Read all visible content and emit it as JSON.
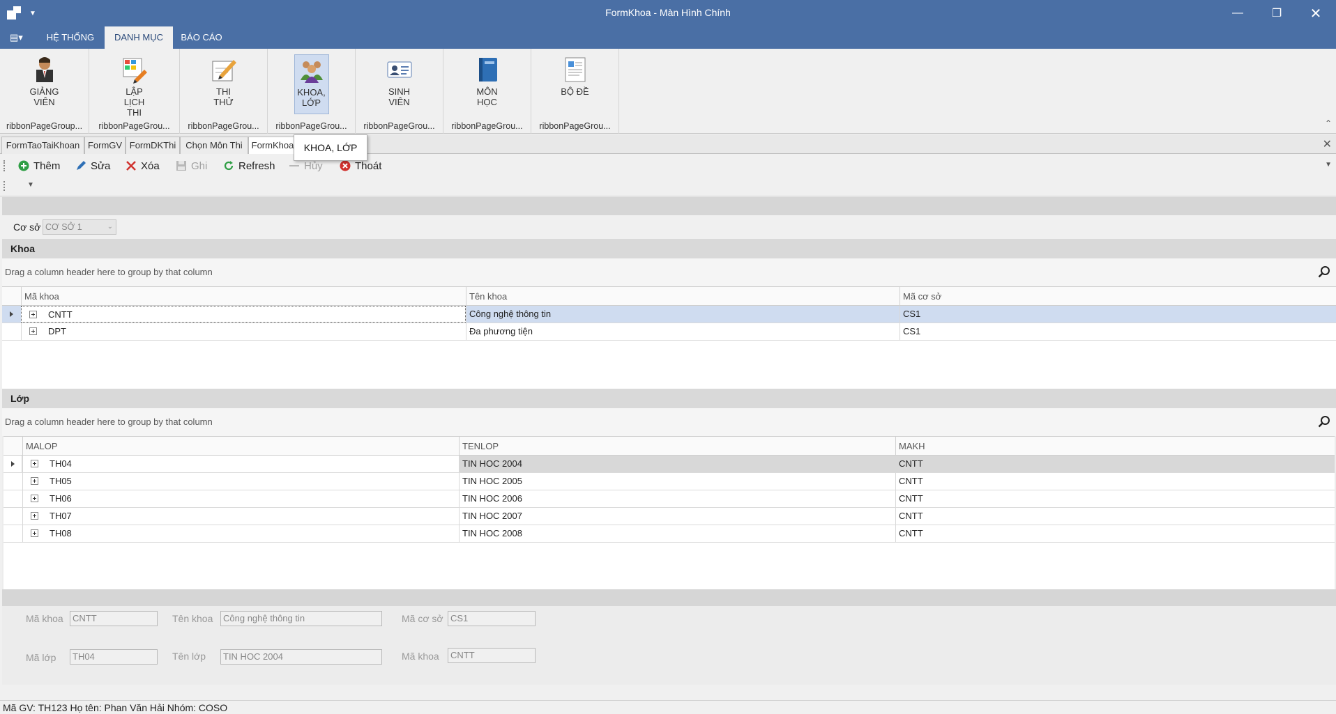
{
  "window": {
    "title": "FormKhoa - Màn Hình Chính"
  },
  "ribbon": {
    "tabs": [
      "HỆ THỐNG",
      "DANH MỤC",
      "BÁO CÁO"
    ],
    "groups": [
      {
        "label": "GIẢNG\nVIÊN",
        "caption": "ribbonPageGroup..."
      },
      {
        "label": "LẬP LỊCH\nTHI",
        "caption": "ribbonPageGrou..."
      },
      {
        "label": "THI THỬ",
        "caption": "ribbonPageGrou..."
      },
      {
        "label": "KHOA,\nLỚP",
        "caption": "ribbonPageGrou..."
      },
      {
        "label": "SINH VIÊN",
        "caption": "ribbonPageGrou..."
      },
      {
        "label": "MÔN HỌC",
        "caption": "ribbonPageGrou..."
      },
      {
        "label": "BỘ ĐỀ",
        "caption": "ribbonPageGrou..."
      }
    ]
  },
  "doc_tabs": [
    "FormTaoTaiKhoan",
    "FormGV",
    "FormDKThi",
    "Chọn Môn Thi",
    "FormKhoa"
  ],
  "tooltip": "KHOA, LỚP",
  "toolbar": {
    "add": "Thêm",
    "edit": "Sửa",
    "delete": "Xóa",
    "save": "Ghi",
    "refresh": "Refresh",
    "cancel": "Hủy",
    "exit": "Thoát"
  },
  "filter": {
    "label": "Cơ sở",
    "value": "CƠ SỞ 1"
  },
  "khoa": {
    "title": "Khoa",
    "group_hint": "Drag a column header here to group by that column",
    "columns": [
      "Mã khoa",
      "Tên khoa",
      "Mã cơ sở"
    ],
    "rows": [
      [
        "CNTT",
        "Công nghệ thông tin",
        "CS1"
      ],
      [
        "DPT",
        "Đa phương tiện",
        "CS1"
      ]
    ]
  },
  "lop": {
    "title": "Lớp",
    "group_hint": "Drag a column header here to group by that column",
    "columns": [
      "MALOP",
      "TENLOP",
      "MAKH"
    ],
    "rows": [
      [
        "TH04",
        "TIN HOC 2004",
        "CNTT"
      ],
      [
        "TH05",
        "TIN HOC 2005",
        "CNTT"
      ],
      [
        "TH06",
        "TIN HOC 2006",
        "CNTT"
      ],
      [
        "TH07",
        "TIN HOC 2007",
        "CNTT"
      ],
      [
        "TH08",
        "TIN HOC 2008",
        "CNTT"
      ]
    ]
  },
  "detail": {
    "ma_khoa_label": "Mã khoa",
    "ma_khoa": "CNTT",
    "ten_khoa_label": "Tên khoa",
    "ten_khoa": "Công nghệ thông tin",
    "ma_coso_label": "Mã cơ sở",
    "ma_coso": "CS1",
    "ma_lop_label": "Mã lớp",
    "ma_lop": "TH04",
    "ten_lop_label": "Tên lớp",
    "ten_lop": "TIN HOC 2004",
    "ma_khoa2_label": "Mã khoa",
    "ma_khoa2": "CNTT"
  },
  "status": "Mã GV: TH123   Họ tên: Phan Văn Hải   Nhóm: COSO",
  "colors": {
    "titlebar": "#4a6fa5",
    "selected_row": "#cfdcf0",
    "lop_selected_row": "#d8d8d8"
  }
}
